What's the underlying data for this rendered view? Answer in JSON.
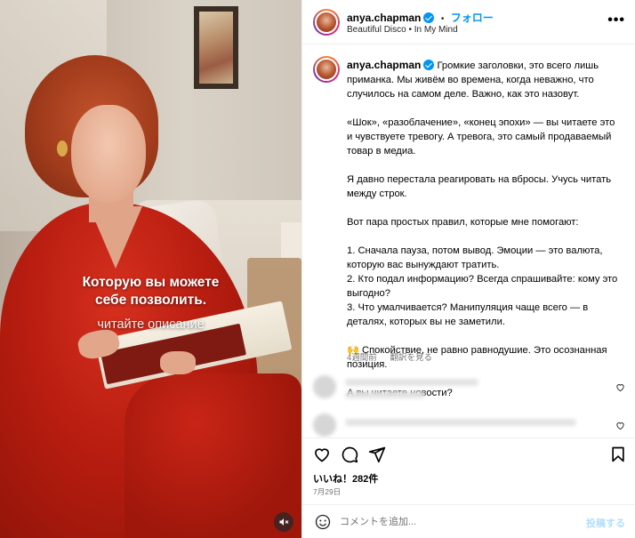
{
  "media": {
    "caption_line1": "Которую вы можете",
    "caption_line2": "себе позволить.",
    "caption_sub": "читайте описание"
  },
  "header": {
    "username": "anya.chapman",
    "follow_label": "フォロー",
    "separator": "•",
    "audio": "Beautiful Disco • In My Mind",
    "more_label": "•••"
  },
  "post": {
    "username": "anya.chapman",
    "caption_first": "Громкие заголовки, это всего лишь приманка. Мы живём во времена, когда неважно, что случилось на самом деле. Важно, как это назовут.",
    "paragraphs": [
      "«Шок», «разоблачение», «конец эпохи» — вы читаете это и чувствуете тревогу. А тревога, это самый продаваемый товар в медиа.",
      "Я давно перестала реагировать на вбросы. Учусь читать между строк.",
      "Вот пара простых правил, которые мне помогают:",
      "1. Сначала пауза, потом вывод. Эмоции — это валюта, которую вас вынуждают тратить.\n2. Кто подал информацию? Всегда спрашивайте: кому это выгодно?\n3. Что умалчивается? Манипуляция чаще всего — в деталях, которых вы не заметили.",
      "🙌 Спокойствие, не равно равнодушие. Это осознанная позиция.",
      "А вы читаете новости?"
    ],
    "time_ago": "4週間前",
    "translate_label": "翻訳を見る"
  },
  "footer": {
    "likes": "いいね！282件",
    "date": "7月29日",
    "comment_placeholder": "コメントを追加...",
    "post_label": "投稿する"
  },
  "icons": {
    "heart": "heart-icon",
    "comment": "comment-icon",
    "share": "share-icon",
    "bookmark": "bookmark-icon",
    "emoji": "emoji-icon",
    "mute": "mute-icon"
  },
  "colors": {
    "accent": "#0095f6",
    "dress": "#b81d10",
    "post_disabled": "#b2dffc"
  }
}
